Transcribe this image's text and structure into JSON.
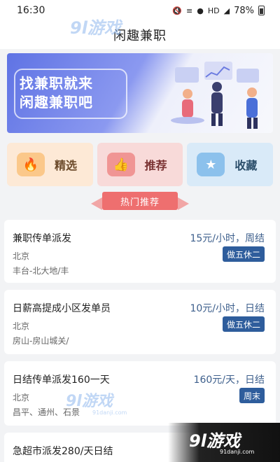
{
  "status_bar": {
    "time": "16:30",
    "icons": [
      "mute-icon",
      "vibrate-icon",
      "wifi-icon",
      "hd-icon",
      "signal-icon"
    ],
    "battery": "78%"
  },
  "header": {
    "title": "闲趣兼职"
  },
  "banner": {
    "line1": "找兼职就来",
    "line2": "闲趣兼职吧"
  },
  "quick_actions": [
    {
      "label": "精选",
      "icon": "flame-icon",
      "color": "#fbc88a"
    },
    {
      "label": "推荐",
      "icon": "thumbs-up-icon",
      "color": "#f09594"
    },
    {
      "label": "收藏",
      "icon": "star-icon",
      "color": "#8cc1ec"
    }
  ],
  "section": {
    "label": "热门推荐"
  },
  "jobs": [
    {
      "title": "兼职传单派发",
      "pay": "15元/小时，周结",
      "city": "北京",
      "address": "丰台-北大地/丰",
      "badge": "做五休二"
    },
    {
      "title": "日薪高提成小区发单员",
      "pay": "10元/小时，日结",
      "city": "北京",
      "address": "房山-房山城关/",
      "badge": "做五休二"
    },
    {
      "title": "日结传单派发160一天",
      "pay": "160元/天，日结",
      "city": "北京",
      "address": "昌平、通州、石景",
      "badge": "周末"
    },
    {
      "title": "急超市派发280/天日结",
      "pay": "",
      "city": "",
      "address": "",
      "badge": ""
    }
  ],
  "watermarks": {
    "logo": "9l游戏",
    "site": "91danji.com"
  },
  "colors": {
    "accent": "#2e5d9c",
    "tag": "#ee6f6f",
    "banner": "#5f73e4"
  }
}
